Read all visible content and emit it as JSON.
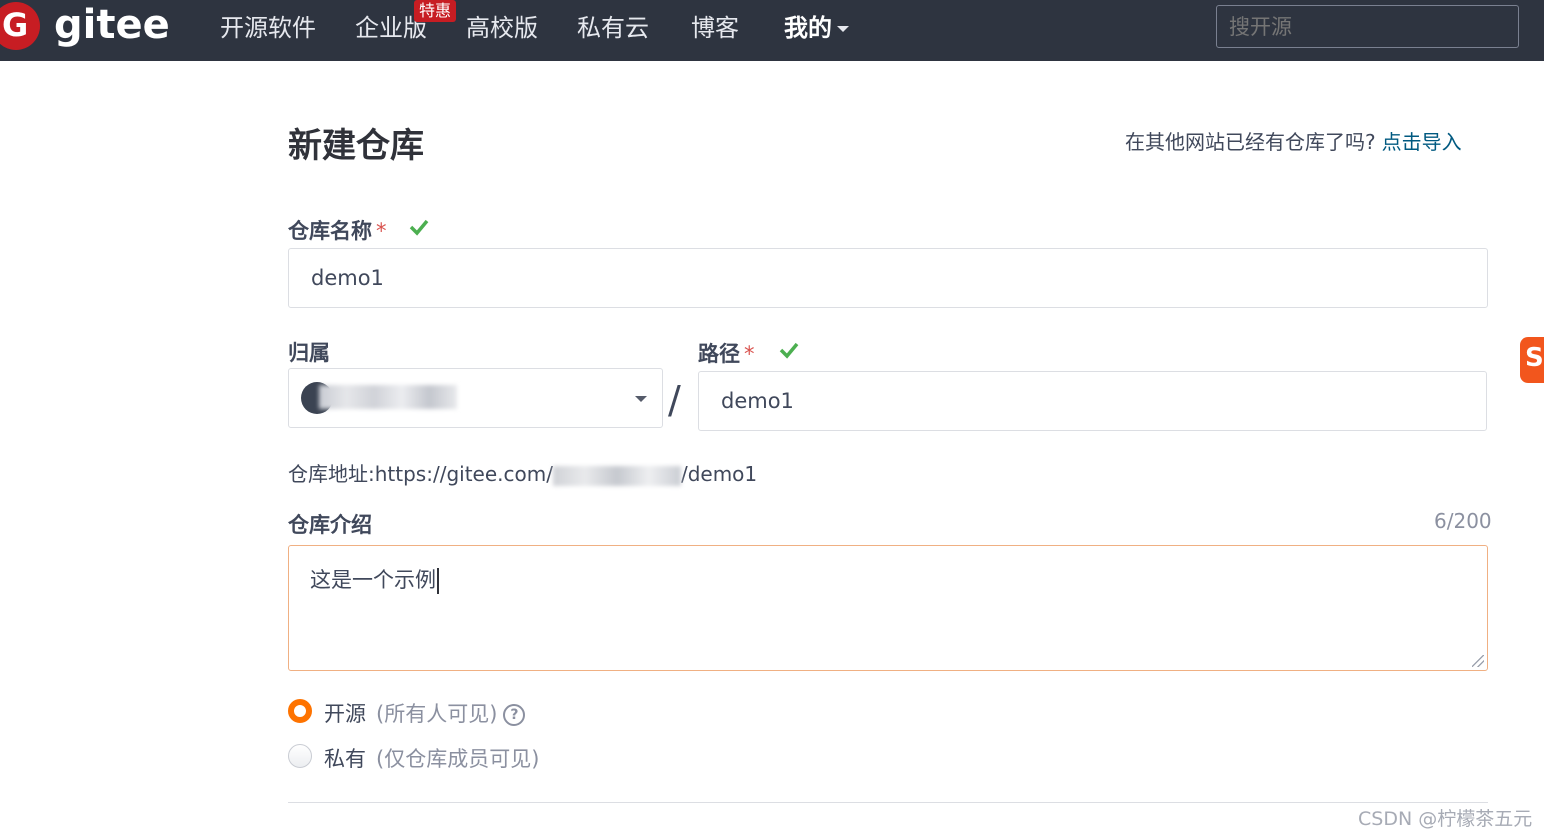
{
  "nav": {
    "logo_letter": "G",
    "logo_text": "gitee",
    "items": [
      "开源软件",
      "企业版",
      "高校版",
      "私有云",
      "博客"
    ],
    "badge": "特惠",
    "mine": "我的",
    "search_placeholder": "搜开源"
  },
  "form": {
    "title": "新建仓库",
    "import_question": "在其他网站已经有仓库了吗?",
    "import_link": "点击导入",
    "repo_name_label": "仓库名称",
    "required_mark": "*",
    "repo_name_value": "demo1",
    "owner_label": "归属",
    "path_label": "路径",
    "path_value": "demo1",
    "slash": "/",
    "address_label": "仓库地址:",
    "address_prefix": "https://gitee.com/",
    "address_suffix": "/demo1",
    "intro_label": "仓库介绍",
    "intro_counter": "6/200",
    "intro_value": "这是一个示例",
    "visibility": {
      "public_label": "开源",
      "public_sub": "(所有人可见)",
      "help_glyph": "?",
      "private_label": "私有",
      "private_sub": "(仅仓库成员可见)",
      "selected": "public"
    }
  },
  "side_tab_letter": "S",
  "watermark": "CSDN @柠檬茶五元",
  "colors": {
    "nav_bg": "#2e3440",
    "brand_red": "#c71d23",
    "accent_orange": "#fe7300",
    "link": "#005980",
    "success": "#4caf50"
  }
}
